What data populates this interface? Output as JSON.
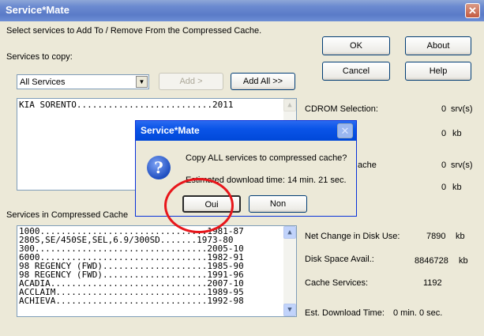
{
  "window": {
    "title": "Service*Mate",
    "close": "✕"
  },
  "main": {
    "instruction": "Select services to Add To / Remove From the Compressed Cache.",
    "services_to_copy_label": "Services to copy:",
    "filter_selected": "All Services",
    "add_label": "Add >",
    "add_all_label": "Add All >>",
    "source_list": [
      "KIA SORENTO..........................2011"
    ],
    "cache_label": "Services in Compressed Cache",
    "cache_list": [
      "1000................................1981-87",
      "280S,SE/450SE,SEL,6.9/300SD.......1973-80",
      "300.................................2005-10",
      "6000................................1982-91",
      "98 REGENCY (FWD)....................1985-90",
      "98 REGENCY (FWD)....................1991-96",
      "ACADIA..............................2007-10",
      "ACCLAIM.............................1989-95",
      "ACHIEVA.............................1992-98"
    ]
  },
  "buttons": {
    "ok": "OK",
    "about": "About",
    "cancel": "Cancel",
    "help": "Help"
  },
  "stats": {
    "cdrom_label": "CDROM Selection:",
    "cdrom_value": "0",
    "cdrom_unit": "srv(s)",
    "cdrom_kb": "0",
    "kb_unit": "kb",
    "cache_partial_label": "ache",
    "cache_value": "0",
    "cache_unit": "srv(s)",
    "cache_kb": "0",
    "net_change_label": "Net Change in Disk Use:",
    "net_change_value": "7890",
    "net_change_unit": "kb",
    "disk_space_label": "Disk Space Avail.:",
    "disk_space_value": "8846728",
    "disk_space_unit": "kb",
    "cache_services_label": "Cache Services:",
    "cache_services_value": "1192",
    "est_download_label": "Est. Download Time:",
    "est_download_value": "0 min. 0 sec."
  },
  "dialog": {
    "title": "Service*Mate",
    "close": "✕",
    "icon": "question-icon",
    "question": "Copy ALL services to compressed cache?",
    "estimate": "Estimated download time: 14 min. 21 sec.",
    "yes": "Oui",
    "no": "Non"
  },
  "colors": {
    "highlight_circle": "#e8161b",
    "titlebar": "#6b8ad0",
    "dialog_titlebar": "#0a54e8"
  }
}
